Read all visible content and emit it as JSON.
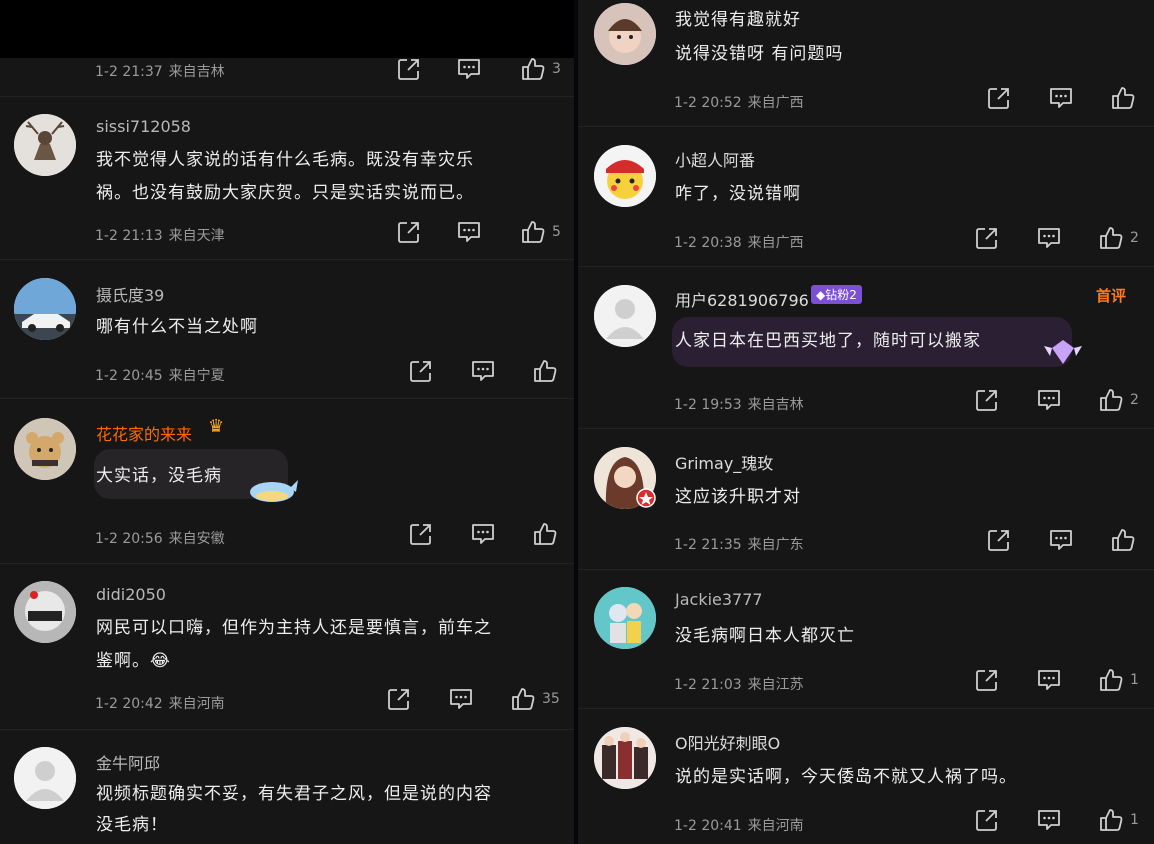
{
  "left": {
    "top_meta": {
      "time": "1-2 21:37",
      "loc": "来自吉林",
      "likes": "3"
    },
    "comments": [
      {
        "user": "sissi712058",
        "line1": "我不觉得人家说的话有什么毛病。既没有幸灾乐",
        "line2": "祸。也没有鼓励大家庆贺。只是实话实说而已。",
        "time": "1-2 21:13",
        "loc": "来自天津",
        "likes": "5"
      },
      {
        "user": "摄氏度39",
        "line1": "哪有什么不当之处啊",
        "time": "1-2 20:45",
        "loc": "来自宁夏",
        "likes": ""
      },
      {
        "user": "花花家的来来",
        "line1": "大实话，没毛病",
        "time": "1-2 20:56",
        "loc": "来自安徽",
        "likes": ""
      },
      {
        "user": "didi2050",
        "line1": "网民可以口嗨，但作为主持人还是要慎言，前车之",
        "line2": "鉴啊。",
        "emoji": "😂",
        "time": "1-2 20:42",
        "loc": "来自河南",
        "likes": "35"
      },
      {
        "user": "金牛阿邱",
        "line1": "视频标题确实不妥，有失君子之风，但是说的内容",
        "line2": "没毛病！"
      }
    ]
  },
  "right": {
    "comments": [
      {
        "line1": "我觉得有趣就好",
        "line2": "说得没错呀 有问题吗",
        "time": "1-2 20:52",
        "loc": "来自广西",
        "likes": ""
      },
      {
        "user": "小超人阿番",
        "line1": "咋了，没说错啊",
        "time": "1-2 20:38",
        "loc": "来自广西",
        "likes": "2"
      },
      {
        "user": "用户6281906796",
        "badge": "钻粉2",
        "tag": "首评",
        "line1": "人家日本在巴西买地了，随时可以搬家",
        "time": "1-2 19:53",
        "loc": "来自吉林",
        "likes": "2"
      },
      {
        "user": "Grimay_瑰玫",
        "line1": "这应该升职才对",
        "time": "1-2 21:35",
        "loc": "来自广东",
        "likes": ""
      },
      {
        "user": "Jackie3777",
        "line1": "没毛病啊日本人都灭亡",
        "time": "1-2 21:03",
        "loc": "来自江苏",
        "likes": "1"
      },
      {
        "user": "O阳光好刺眼O",
        "line1": "说的是实话啊，今天倭岛不就又人祸了吗。",
        "time": "1-2 20:41",
        "loc": "来自河南",
        "likes": "1"
      }
    ]
  },
  "icons": {
    "share": "share-icon",
    "reply": "reply-icon",
    "like": "thumbs-up-icon"
  },
  "colors": {
    "background": "#161616",
    "text": "#ededed",
    "meta": "#9a9a9a",
    "highlight_name": "#ff6a00",
    "badge": "#7b4fd6"
  }
}
